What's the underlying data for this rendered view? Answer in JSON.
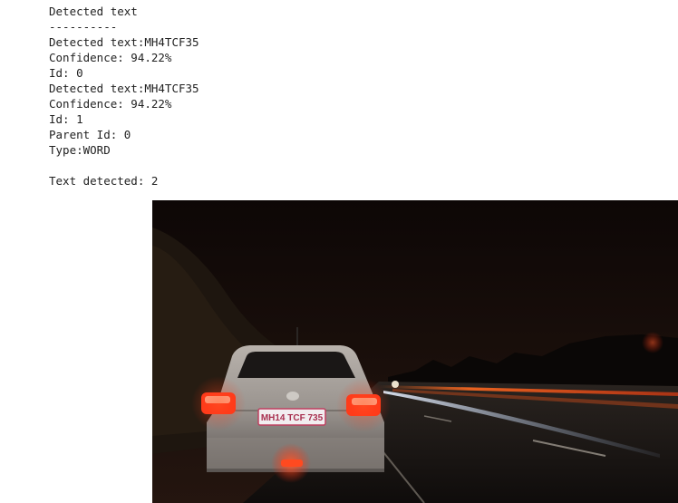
{
  "console": {
    "lines": [
      "Detected text",
      "----------",
      "Detected text:MH4TCF35",
      "Confidence: 94.22%",
      "Id: 0",
      "Detected text:MH4TCF35",
      "Confidence: 94.22%",
      "Id: 1",
      "Parent Id: 0",
      "Type:WORD",
      "",
      "Text detected: 2"
    ]
  },
  "image": {
    "plate_text": "MH14 TCF 735",
    "colors": {
      "sky": "#120b09",
      "road": "#1a1512",
      "taillight": "#ff3a1a",
      "car_body": "#a9a39d"
    }
  }
}
